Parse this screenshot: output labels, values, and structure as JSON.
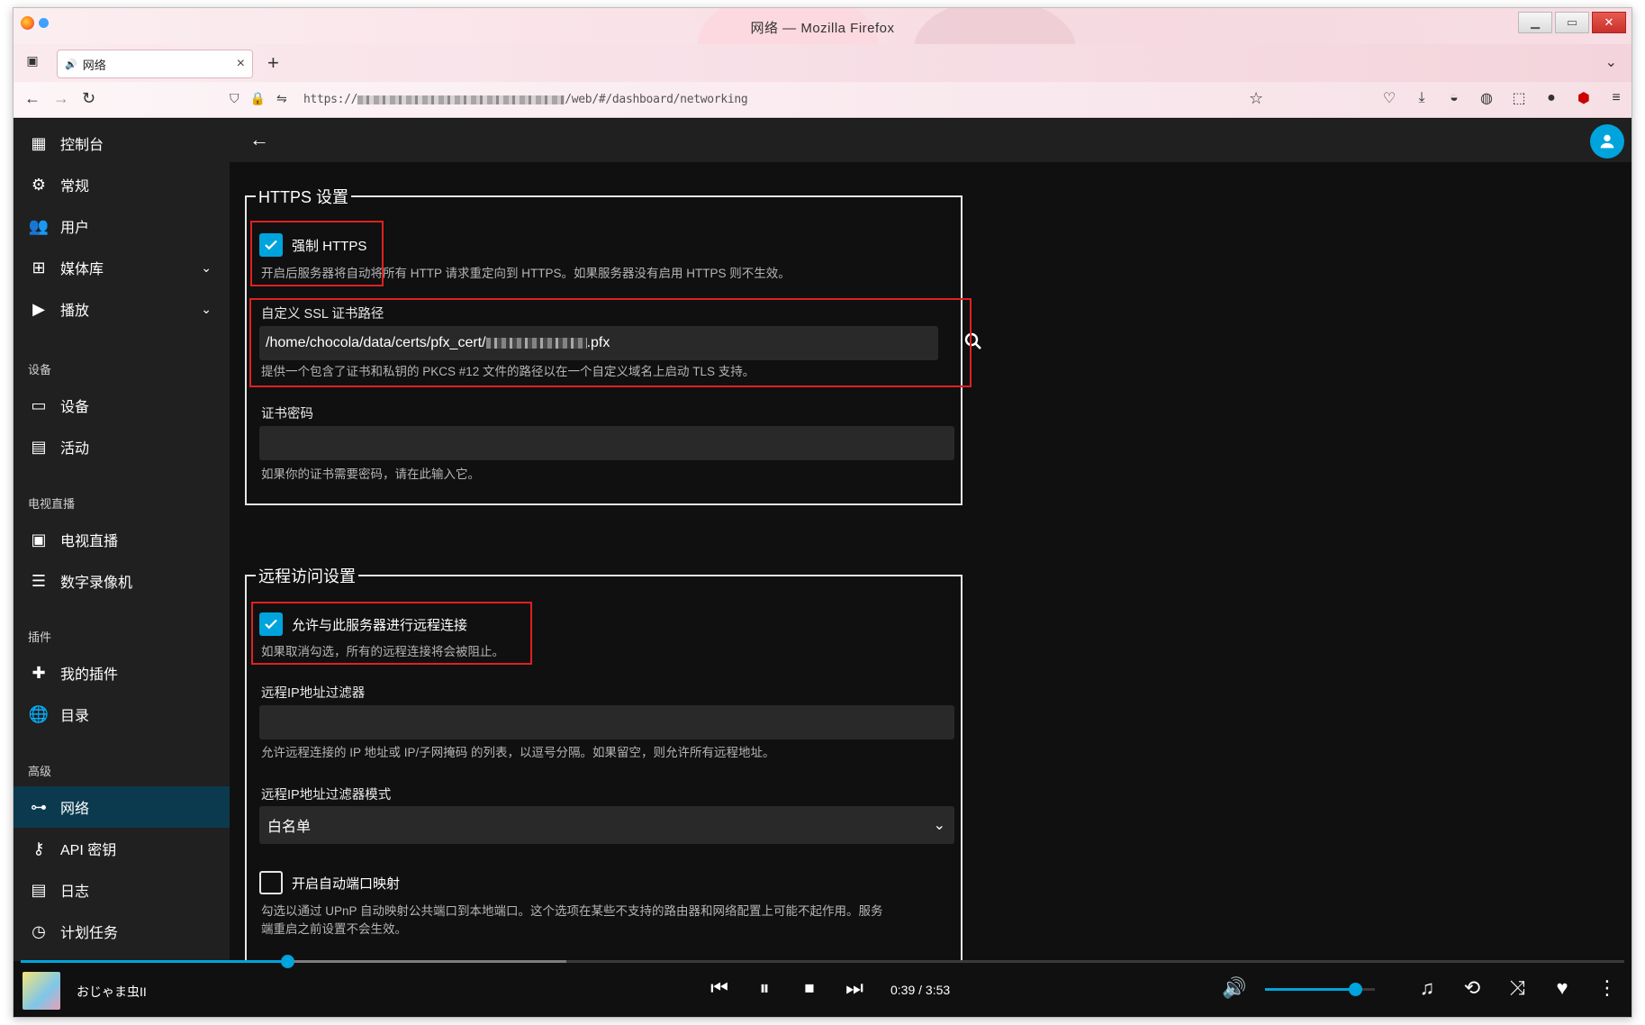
{
  "window": {
    "title": "网络 — Mozilla Firefox",
    "controls": {
      "minimize": "▁",
      "maximize": "▭",
      "close": "✕"
    }
  },
  "tab": {
    "title": "网络",
    "close": "×",
    "new_tab": "+"
  },
  "address_bar": {
    "url_prefix": "https://",
    "url_suffix": "/web/#/dashboard/networking"
  },
  "sidebar": {
    "items": [
      {
        "label": "控制台",
        "icon": "dashboard-icon"
      },
      {
        "label": "常规",
        "icon": "gear-icon"
      },
      {
        "label": "用户",
        "icon": "users-icon"
      },
      {
        "label": "媒体库",
        "icon": "library-add-icon",
        "expandable": true
      },
      {
        "label": "播放",
        "icon": "play-circle-icon",
        "expandable": true
      }
    ],
    "sections": {
      "devices": {
        "title": "设备",
        "items": [
          {
            "label": "设备",
            "icon": "devices-icon"
          },
          {
            "label": "活动",
            "icon": "activity-icon"
          }
        ]
      },
      "livetv": {
        "title": "电视直播",
        "items": [
          {
            "label": "电视直播",
            "icon": "live-tv-icon"
          },
          {
            "label": "数字录像机",
            "icon": "dvr-icon"
          }
        ]
      },
      "plugins": {
        "title": "插件",
        "items": [
          {
            "label": "我的插件",
            "icon": "extension-icon"
          },
          {
            "label": "目录",
            "icon": "globe-icon"
          }
        ]
      },
      "advanced": {
        "title": "高级",
        "items": [
          {
            "label": "网络",
            "icon": "network-icon",
            "active": true
          },
          {
            "label": "API 密钥",
            "icon": "key-icon"
          },
          {
            "label": "日志",
            "icon": "log-icon"
          },
          {
            "label": "计划任务",
            "icon": "clock-icon"
          }
        ]
      }
    }
  },
  "https_section": {
    "legend": "HTTPS 设置",
    "force_https": {
      "label": "强制 HTTPS",
      "checked": true,
      "help": "开启后服务器将自动将所有 HTTP 请求重定向到 HTTPS。如果服务器没有启用 HTTPS 则不生效。"
    },
    "cert_path": {
      "label": "自定义 SSL 证书路径",
      "value_prefix": "/home/chocola/data/certs/pfx_cert/",
      "value_suffix": ".pfx",
      "help": "提供一个包含了证书和私钥的 PKCS #12 文件的路径以在一个自定义域名上启动 TLS 支持。"
    },
    "cert_password": {
      "label": "证书密码",
      "value": "",
      "help": "如果你的证书需要密码，请在此输入它。"
    }
  },
  "remote_section": {
    "legend": "远程访问设置",
    "allow_remote": {
      "label": "允许与此服务器进行远程连接",
      "checked": true,
      "help": "如果取消勾选，所有的远程连接将会被阻止。"
    },
    "ip_filter": {
      "label": "远程IP地址过滤器",
      "value": "",
      "help": "允许远程连接的 IP 地址或 IP/子网掩码 的列表，以逗号分隔。如果留空，则允许所有远程地址。"
    },
    "ip_filter_mode": {
      "label": "远程IP地址过滤器模式",
      "selected": "白名单"
    },
    "upnp": {
      "label": "开启自动端口映射",
      "checked": false,
      "help_line1": "勾选以通过 UPnP 自动映射公共端口到本地端口。这个选项在某些不支持的路由器和网络配置上可能不起作用。服务",
      "help_line2": "端重启之前设置不会生效。"
    }
  },
  "player": {
    "track_title": "おじゃま虫II",
    "time": "0:39 / 3:53",
    "progress_fraction": 0.166,
    "buffered_fraction": 0.34,
    "volume_fraction": 0.82
  },
  "colors": {
    "accent": "#00a4dc",
    "highlight_box": "#e02020",
    "sidebar_bg": "#202020",
    "page_bg": "#101010",
    "active_item_bg": "#0b3a4e"
  }
}
